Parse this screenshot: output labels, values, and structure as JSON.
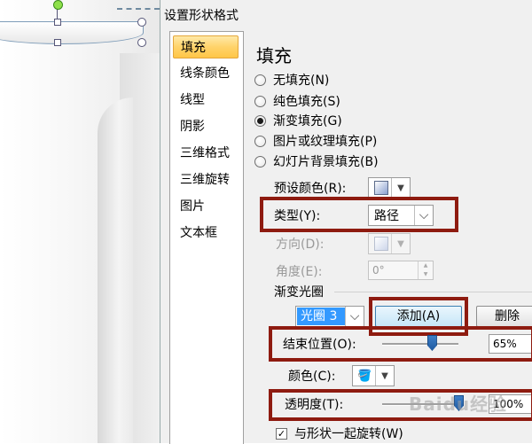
{
  "dialog": {
    "title": "设置形状格式"
  },
  "nav": {
    "items": [
      {
        "label": "填充",
        "active": true
      },
      {
        "label": "线条颜色"
      },
      {
        "label": "线型"
      },
      {
        "label": "阴影"
      },
      {
        "label": "三维格式"
      },
      {
        "label": "三维旋转"
      },
      {
        "label": "图片"
      },
      {
        "label": "文本框"
      }
    ]
  },
  "fill": {
    "heading": "填充",
    "options": [
      {
        "label": "无填充(N)",
        "checked": false
      },
      {
        "label": "纯色填充(S)",
        "checked": false
      },
      {
        "label": "渐变填充(G)",
        "checked": true
      },
      {
        "label": "图片或纹理填充(P)",
        "checked": false
      },
      {
        "label": "幻灯片背景填充(B)",
        "checked": false
      }
    ],
    "preset_label": "预设颜色(R):",
    "type_label": "类型(Y):",
    "type_value": "路径",
    "direction_label": "方向(D):",
    "angle_label": "角度(E):",
    "angle_value": "0°",
    "gradient_stops_label": "渐变光圈",
    "stop_selected": "光圈 3",
    "add_button": "添加(A)",
    "delete_button": "删除",
    "end_position_label": "结束位置(O):",
    "end_position_value": "65%",
    "end_position_fraction": 0.65,
    "color_label": "颜色(C):",
    "transparency_label": "透明度(T):",
    "transparency_value": "100%",
    "transparency_fraction": 1.0,
    "rotate_with_shape_label": "与形状一起旋转(W)",
    "rotate_with_shape_checked": true
  },
  "watermark": {
    "text": "Baidu经验"
  },
  "colors": {
    "highlight_box": "#8e1b10",
    "nav_active": "#ffc647",
    "selected_stop": "#3399ff"
  }
}
